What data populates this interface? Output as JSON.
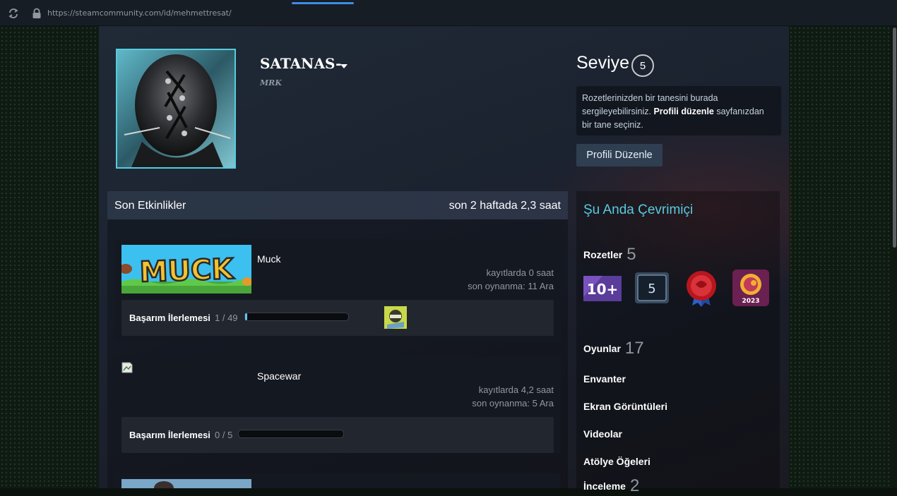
{
  "browser": {
    "url": "https://steamcommunity.com/id/mehmettresat/"
  },
  "profile": {
    "persona_name": "SATANAS-",
    "real_name": "MRK",
    "level_label": "Seviye",
    "level": "5",
    "badge_info_part1": "Rozetlerinizden bir tanesini burada sergileyebilirsiniz. ",
    "badge_info_link": "Profili düzenle",
    "badge_info_part2": " sayfanızdan bir tane seçiniz.",
    "edit_profile_label": "Profili Düzenle"
  },
  "activity": {
    "title": "Son Etkinlikler",
    "hours_summary": "son 2 haftada 2,3 saat",
    "games": [
      {
        "name": "Muck",
        "capsule_text": "MUCK",
        "hours": "kayıtlarda 0 saat",
        "last_played": "son oynanma: 11 Ara",
        "ach_label": "Başarım İlerlemesi",
        "ach_count": "1 / 49",
        "ach_progress": 0.02
      },
      {
        "name": "Spacewar",
        "hours": "kayıtlarda 4,2 saat",
        "last_played": "son oynanma: 5 Ara",
        "ach_label": "Başarım İlerlemesi",
        "ach_count": "0 / 5",
        "ach_progress": 0
      }
    ]
  },
  "sidebar": {
    "online_status": "Şu Anda Çevrimiçi",
    "badges_label": "Rozetler",
    "badges_count": "5",
    "badges": [
      {
        "name": "years-of-service-badge",
        "text": "10+"
      },
      {
        "name": "level-5-badge",
        "text": "5"
      },
      {
        "name": "wax-seal-badge",
        "text": ""
      },
      {
        "name": "steam-2023-badge",
        "text": "2023"
      }
    ],
    "games_label": "Oyunlar",
    "games_count": "17",
    "inventory_label": "Envanter",
    "screenshots_label": "Ekran Görüntüleri",
    "videos_label": "Videolar",
    "workshop_label": "Atölye Öğeleri",
    "reviews_label": "İnceleme",
    "reviews_count": "2"
  },
  "colors": {
    "accent": "#57cbde",
    "progress": "#67c1f5",
    "tab_indicator": "#3d8ee6"
  }
}
